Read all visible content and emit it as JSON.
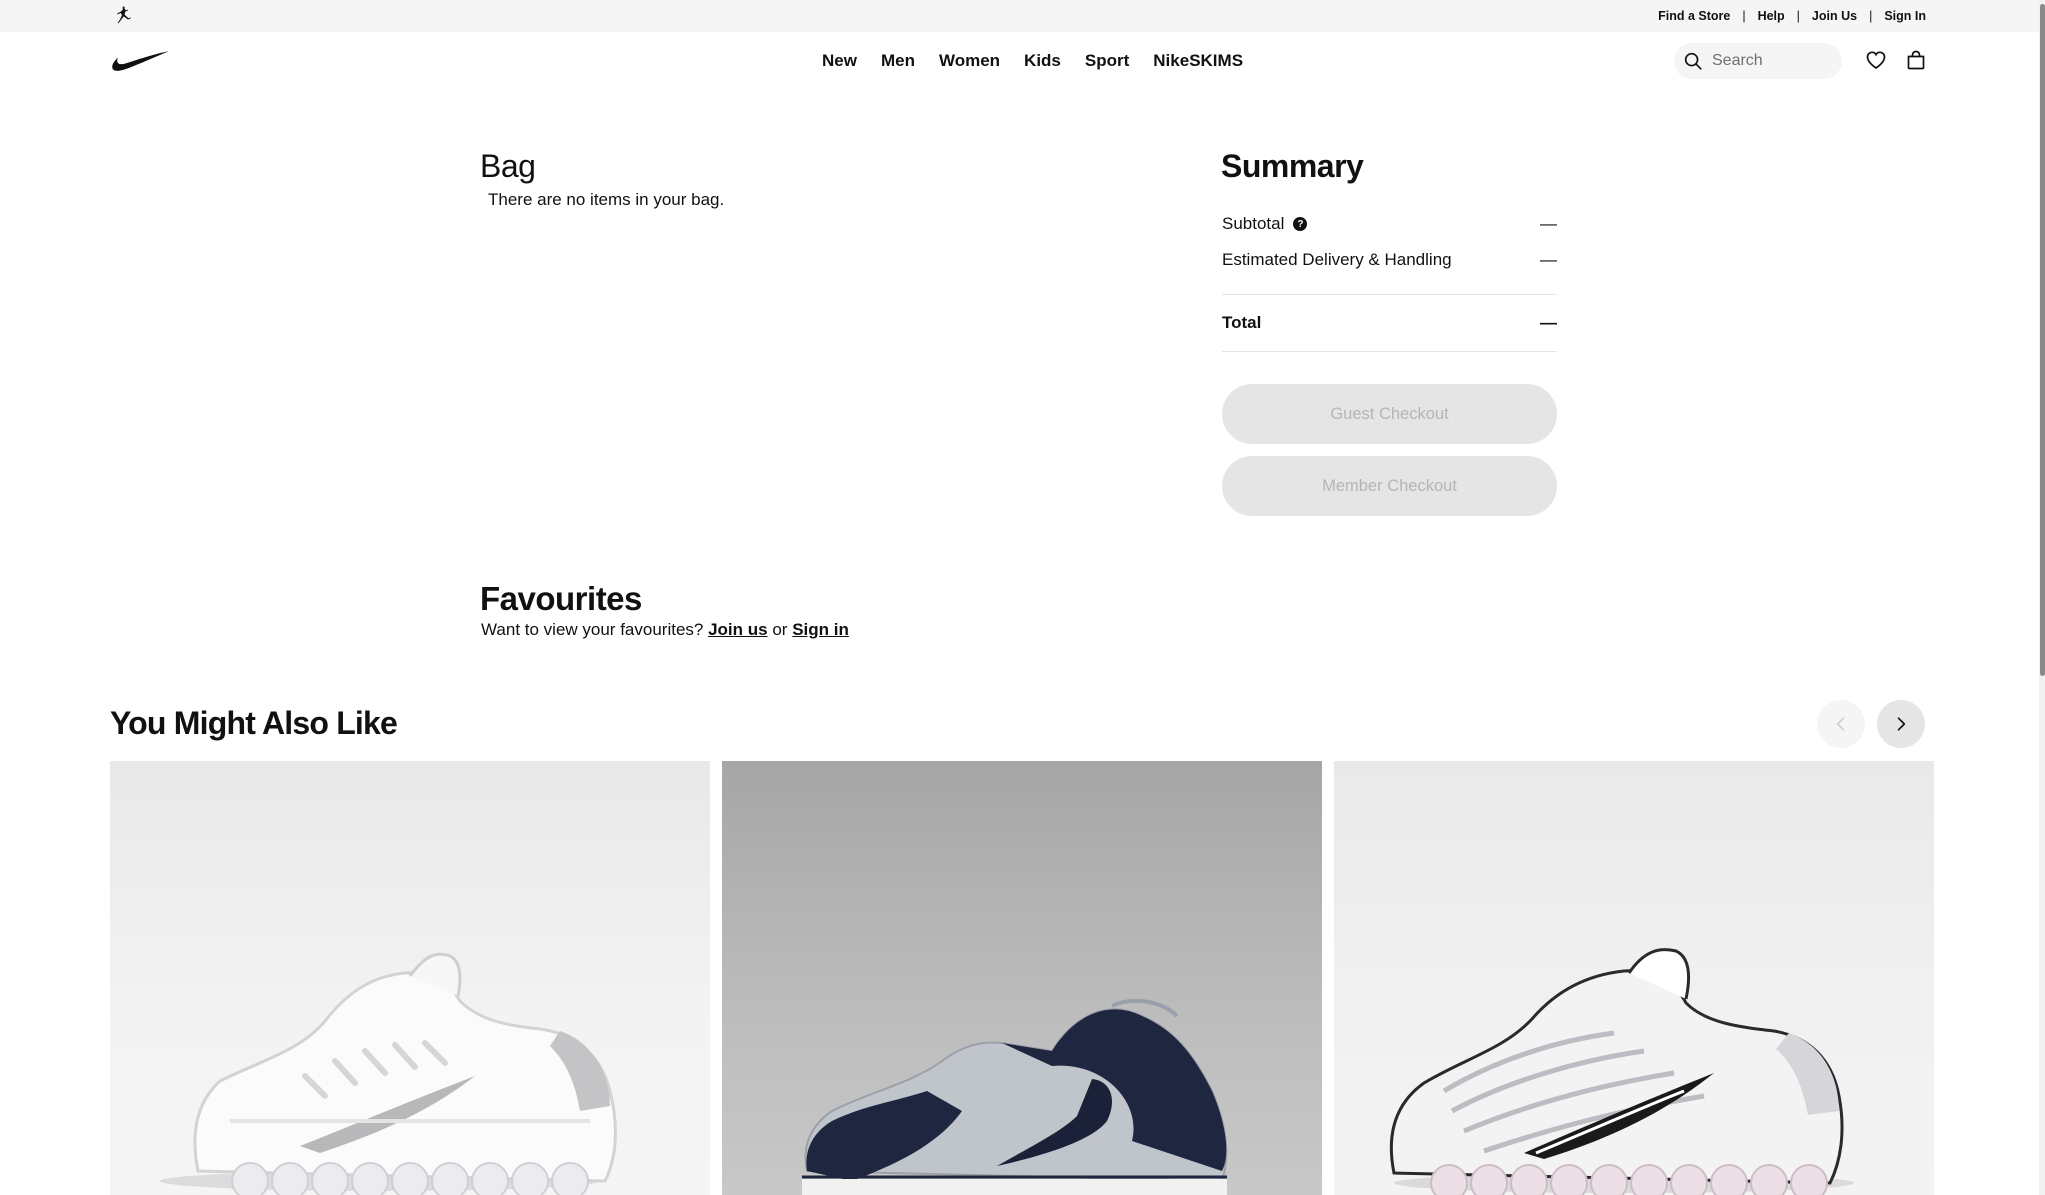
{
  "utility_bar": {
    "links": [
      "Find a Store",
      "Help",
      "Join Us",
      "Sign In"
    ],
    "separator": "|"
  },
  "nav": {
    "items": [
      "New",
      "Men",
      "Women",
      "Kids",
      "Sport",
      "NikeSKIMS"
    ]
  },
  "search": {
    "placeholder": "Search"
  },
  "bag": {
    "title": "Bag",
    "empty_message": "There are no items in your bag."
  },
  "summary": {
    "title": "Summary",
    "subtotal_label": "Subtotal",
    "subtotal_value": "—",
    "delivery_label": "Estimated Delivery & Handling",
    "delivery_value": "—",
    "total_label": "Total",
    "total_value": "—",
    "help_glyph": "?",
    "guest_checkout_label": "Guest Checkout",
    "member_checkout_label": "Member Checkout"
  },
  "favourites": {
    "title": "Favourites",
    "prompt": "Want to view your favourites?",
    "join_link": "Join us",
    "or_text": "or",
    "signin_link": "Sign in"
  },
  "recommendations": {
    "title": "You Might Also Like",
    "products": [
      {
        "image": "white-silver-running-shoe"
      },
      {
        "image": "navy-grey-white-low-sneaker"
      },
      {
        "image": "white-silver-black-swoosh-running-shoe"
      }
    ]
  },
  "colors": {
    "text": "#111111",
    "disabled_button_bg": "#e5e5e5",
    "disabled_button_text": "#b5b5b5",
    "utility_bar_bg": "#f5f5f5"
  },
  "icons": {
    "brand": "nike-swoosh-icon",
    "jordan": "jumpman-icon",
    "search": "search-icon",
    "favourites": "heart-icon",
    "bag": "bag-icon",
    "prev": "chevron-left-icon",
    "next": "chevron-right-icon"
  }
}
